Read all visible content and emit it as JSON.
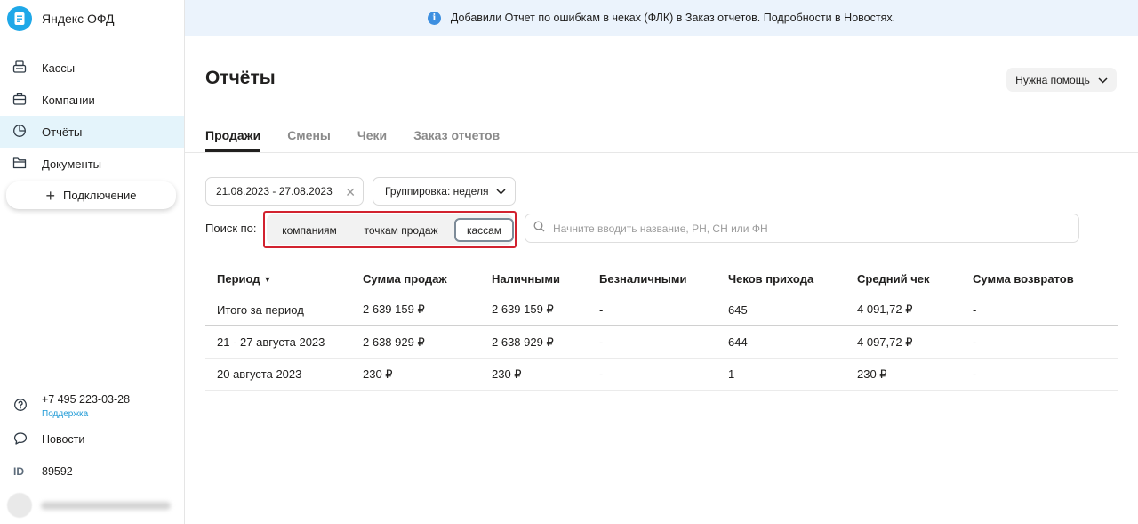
{
  "app": {
    "title": "Яндекс ОФД",
    "accent": "#1fa8e8"
  },
  "sidebar": {
    "items": [
      {
        "label": "Кассы",
        "icon": "cash-register-icon",
        "active": false
      },
      {
        "label": "Компании",
        "icon": "briefcase-icon",
        "active": false
      },
      {
        "label": "Отчёты",
        "icon": "pie-chart-icon",
        "active": true
      },
      {
        "label": "Документы",
        "icon": "folder-icon",
        "active": false
      }
    ],
    "connect_label": "Подключение",
    "phone": "+7 495 223-03-28",
    "support_label": "Поддержка",
    "news_label": "Новости",
    "id_label": "ID",
    "id_value": "89592"
  },
  "banner": {
    "text": "Добавили Отчет по ошибкам в чеках (ФЛК) в Заказ отчетов. Подробности в Новостях."
  },
  "header": {
    "title": "Отчёты",
    "help_label": "Нужна помощь"
  },
  "tabs": [
    {
      "label": "Продажи",
      "active": true
    },
    {
      "label": "Смены",
      "active": false
    },
    {
      "label": "Чеки",
      "active": false
    },
    {
      "label": "Заказ отчетов",
      "active": false
    }
  ],
  "filters": {
    "date_range": "21.08.2023 - 27.08.2023",
    "grouping": "Группировка: неделя",
    "search_by_label": "Поиск по:",
    "search_options": [
      "компаниям",
      "точкам продаж",
      "кассам"
    ],
    "selected_option": "кассам",
    "search_placeholder": "Начните вводить название, РН, СН или ФН"
  },
  "table": {
    "columns": [
      "Период",
      "Сумма продаж",
      "Наличными",
      "Безналичными",
      "Чеков прихода",
      "Средний чек",
      "Сумма возвратов"
    ],
    "rows": [
      [
        "Итого за период",
        "2 639 159 ₽",
        "2 639 159 ₽",
        "-",
        "645",
        "4 091,72 ₽",
        "-"
      ],
      [
        "21 - 27 августа 2023",
        "2 638 929 ₽",
        "2 638 929 ₽",
        "-",
        "644",
        "4 097,72 ₽",
        "-"
      ],
      [
        "20 августа 2023",
        "230 ₽",
        "230 ₽",
        "-",
        "1",
        "230 ₽",
        "-"
      ]
    ]
  }
}
